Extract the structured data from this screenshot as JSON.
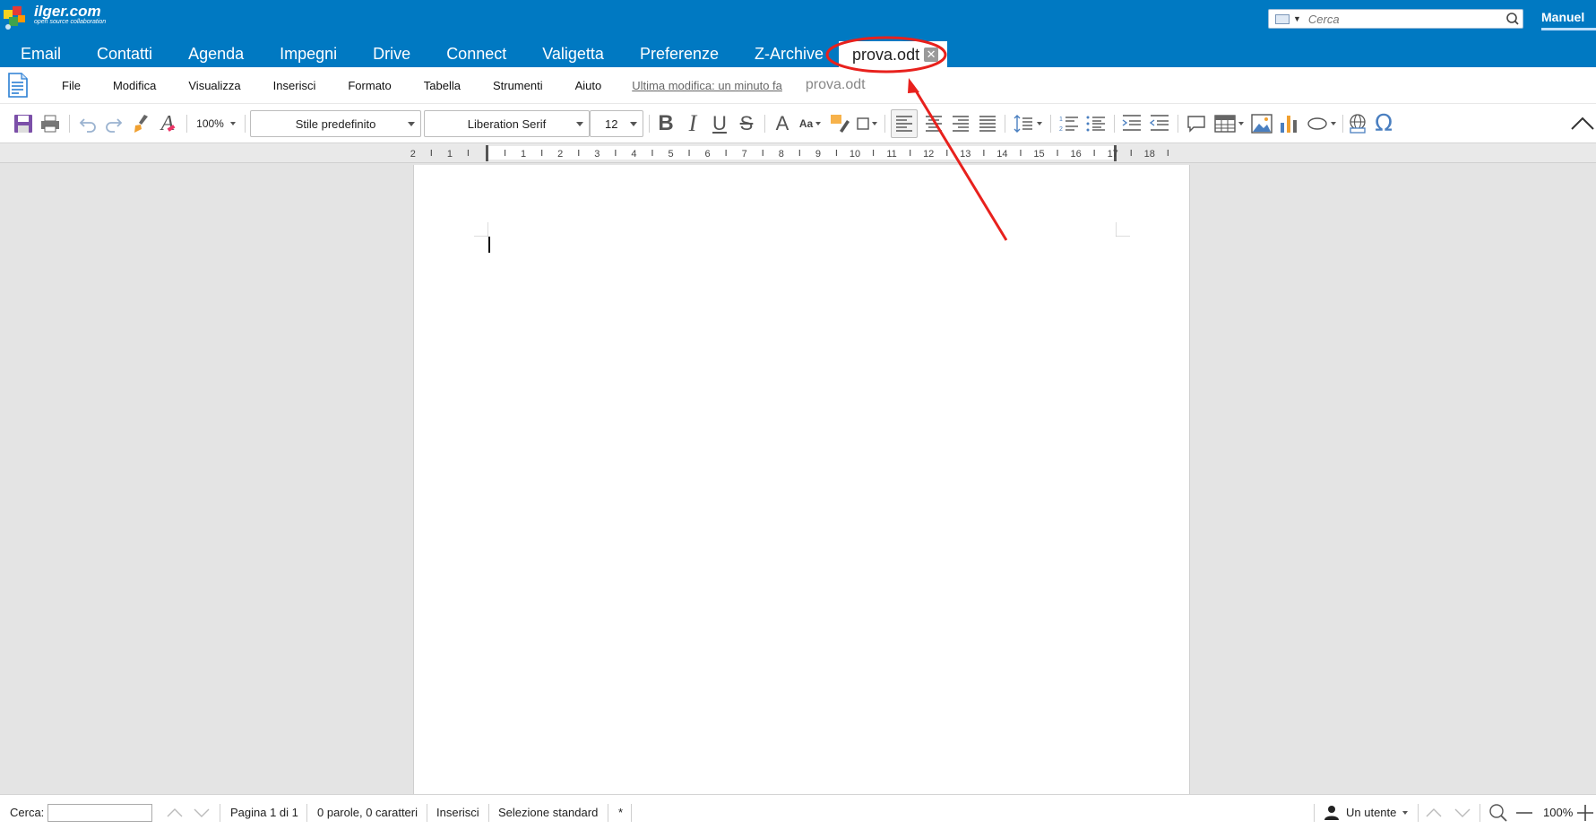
{
  "brand": {
    "name": "ilger.com",
    "tagline": "open source collaboration"
  },
  "search": {
    "placeholder": "Cerca"
  },
  "user": {
    "name": "Manuel"
  },
  "tabs": [
    {
      "label": "Email"
    },
    {
      "label": "Contatti"
    },
    {
      "label": "Agenda"
    },
    {
      "label": "Impegni"
    },
    {
      "label": "Drive"
    },
    {
      "label": "Connect"
    },
    {
      "label": "Valigetta"
    },
    {
      "label": "Preferenze"
    },
    {
      "label": "Z-Archive"
    }
  ],
  "active_tab": {
    "label": "prova.odt",
    "close_glyph": "✕"
  },
  "menubar": {
    "items": [
      "File",
      "Modifica",
      "Visualizza",
      "Inserisci",
      "Formato",
      "Tabella",
      "Strumenti",
      "Aiuto"
    ],
    "last_modified": "Ultima modifica: un minuto fa",
    "document_name": "prova.odt"
  },
  "toolbar": {
    "zoom": "100%",
    "paragraph_style": "Stile predefinito",
    "font_name": "Liberation Serif",
    "font_size": "12",
    "icons": [
      "save-icon",
      "print-icon",
      "undo-icon",
      "redo-icon",
      "clone-formatting-icon",
      "clear-formatting-icon",
      "bold-icon",
      "italic-icon",
      "underline-icon",
      "strikethrough-icon",
      "font-color-icon",
      "case-icon",
      "highlight-icon",
      "border-icon",
      "align-left-icon",
      "align-center-icon",
      "align-right-icon",
      "justify-icon",
      "line-spacing-icon",
      "numbered-list-icon",
      "bullet-list-icon",
      "indent-icon",
      "outdent-icon",
      "comment-icon",
      "table-icon",
      "image-icon",
      "chart-icon",
      "shape-icon",
      "hyperlink-icon",
      "special-character-icon",
      "collapse-icon"
    ]
  },
  "ruler": {
    "labels": [
      "2",
      "1",
      "1",
      "2",
      "3",
      "4",
      "5",
      "6",
      "7",
      "8",
      "9",
      "10",
      "11",
      "12",
      "13",
      "14",
      "15",
      "16",
      "17",
      "18"
    ]
  },
  "statusbar": {
    "find_label": "Cerca:",
    "page": "Pagina 1 di 1",
    "word_count": "0 parole, 0 caratteri",
    "insert_mode": "Inserisci",
    "selection_mode": "Selezione standard",
    "modified_flag": "*",
    "users": "Un utente",
    "zoom": "100%"
  },
  "colors": {
    "brand_blue": "#0079c2",
    "annotation_red": "#e8211d"
  }
}
